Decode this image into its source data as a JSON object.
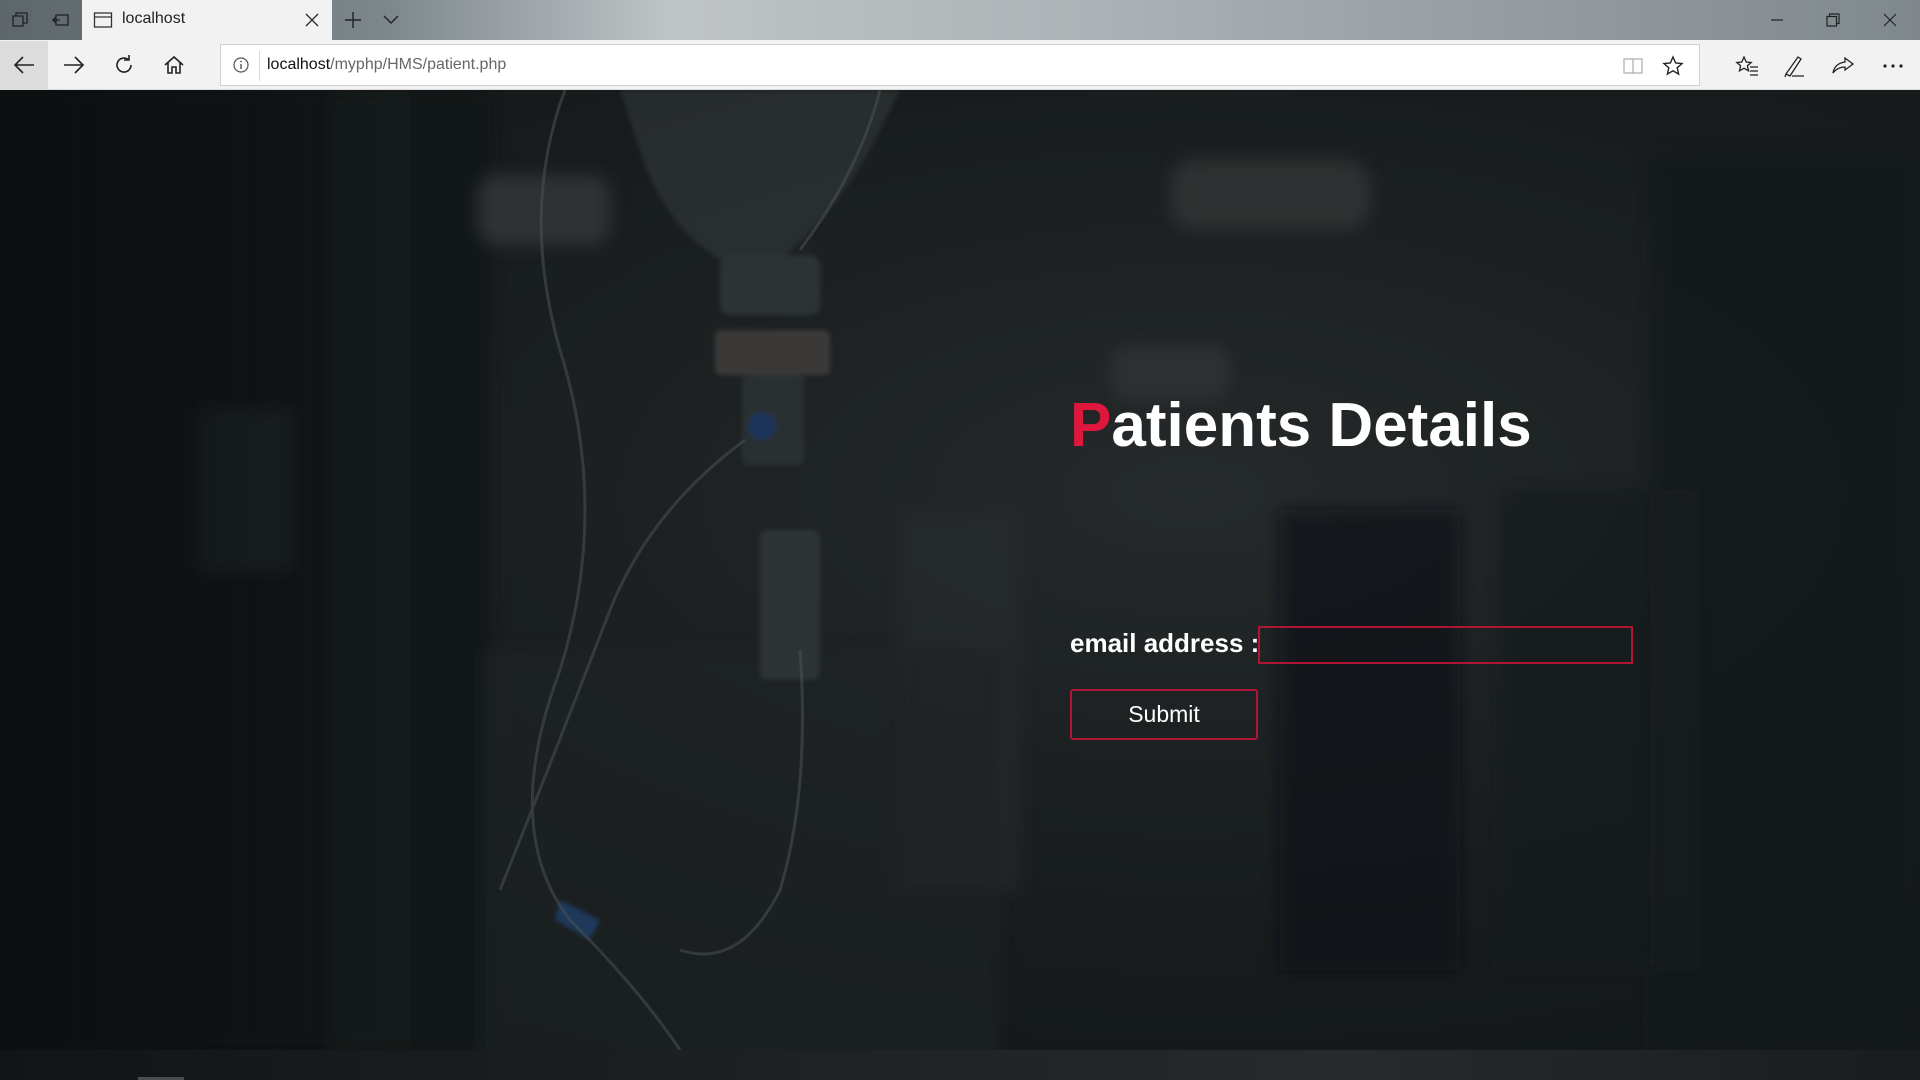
{
  "browser": {
    "tab_title": "localhost",
    "address": {
      "host": "localhost",
      "path": "/myphp/HMS/patient.php"
    }
  },
  "page": {
    "title_first_letter": "P",
    "title_rest": "atients Details",
    "email_label": "email address :",
    "email_value": "",
    "submit_label": "Submit"
  },
  "colors": {
    "accent": "#e0173c",
    "border": "#b01535",
    "chrome_bg": "#f2f2f2"
  },
  "icons": [
    "tab-actions-icon",
    "set-aside-icon",
    "page-icon",
    "close-icon",
    "plus-icon",
    "chevron-down-icon",
    "minimize-icon",
    "restore-icon",
    "back-arrow-icon",
    "forward-arrow-icon",
    "refresh-icon",
    "home-icon",
    "info-icon",
    "reading-view-icon",
    "star-icon",
    "favorites-icon",
    "pen-icon",
    "share-icon",
    "more-icon"
  ]
}
